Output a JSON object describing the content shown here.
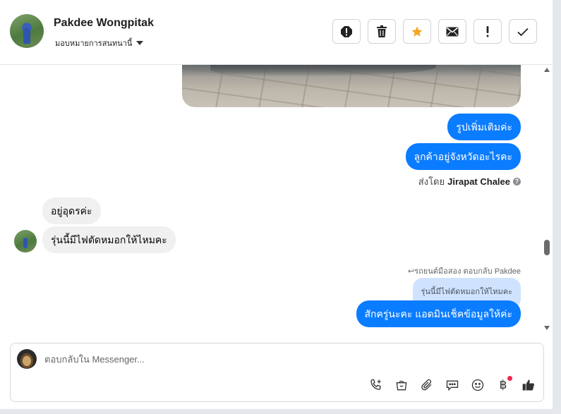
{
  "header": {
    "name": "Pakdee Wongpitak",
    "assign_label": "มอบหมายการสนทนานี้"
  },
  "toolbar": {
    "buttons": [
      "spam-alert",
      "delete",
      "star",
      "mark-unread",
      "follow-up",
      "done"
    ]
  },
  "messages": {
    "out_1": "รูปเพิ่มเติมค่ะ",
    "out_2": "ลูกค้าอยู่จังหวัดอะไรคะ",
    "sent_by_prefix": "ส่งโดย",
    "sent_by_name": "Jirapat Chalee",
    "help_glyph": "?",
    "in_1": "อยู่อุดรค่ะ",
    "in_2": "รุ่นนี้มีไฟตัดหมอกให้ไหมคะ",
    "reply_meta": "รถยนต์มือสอง ตอบกลับ Pakdee",
    "reply_quote": "รุ่นนี้มีไฟตัดหมอกให้ไหมคะ",
    "out_3": "สักครู่นะคะ แอดมินเช็คข้อมูลให้ค่ะ"
  },
  "composer": {
    "placeholder": "ตอบกลับใน Messenger...",
    "baht_symbol": "฿",
    "tools": [
      "call-icon",
      "shop-icon",
      "attach-icon",
      "saved-reply-icon",
      "emoji-icon",
      "baht-icon",
      "like-icon"
    ]
  },
  "colors": {
    "outgoing": "#0a7cff",
    "incoming": "#f0f0f0",
    "star": "#f5a623",
    "notify_dot": "#f02849"
  }
}
